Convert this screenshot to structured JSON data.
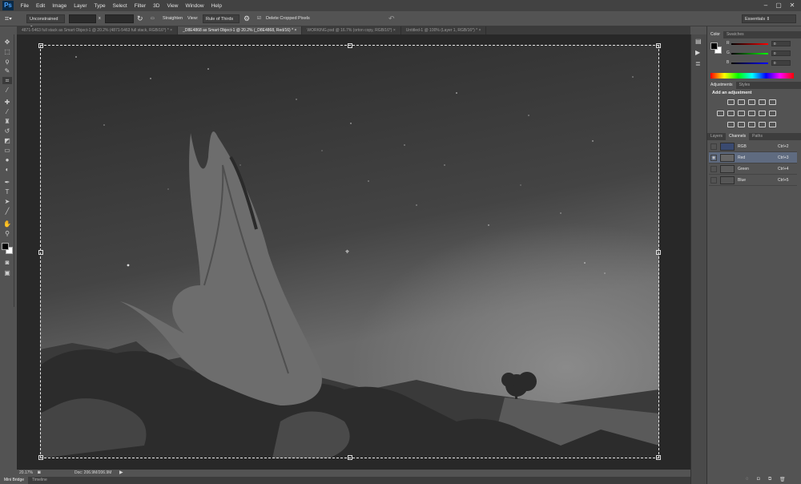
{
  "app": {
    "logo": "Ps"
  },
  "menu": [
    "File",
    "Edit",
    "Image",
    "Layer",
    "Type",
    "Select",
    "Filter",
    "3D",
    "View",
    "Window",
    "Help"
  ],
  "window_controls": {
    "minimize": "–",
    "maximize": "▢",
    "close": "✕"
  },
  "options_bar": {
    "ratio_preset": "Unconstrained",
    "ratio_separator": "x",
    "straighten_label": "Straighten",
    "view_label": "View:",
    "view_value": "Rule of Thirds",
    "delete_cropped_label": "Delete Cropped Pixels",
    "delete_cropped_checked": true,
    "workspace": "Essentials"
  },
  "doc_tabs": [
    {
      "title": "4871-5463 full stack as Smart Object-1 @ 20.2% (4871-5463 full stack, RGB/16*) *",
      "active": false
    },
    {
      "title": "_D8E4868 as Smart Object-1 @ 20.2% (_D8E4868, Red/16) *",
      "active": true
    },
    {
      "title": "WORKING.psd @ 16.7% (orton copy, RGB/16*)",
      "active": false
    },
    {
      "title": "Untitled-1 @ 100% (Layer 1, RGB/16*) *",
      "active": false
    }
  ],
  "tab_close": "×",
  "status": {
    "zoom": "20.17%",
    "doc": "Doc: 206.9M/206.9M"
  },
  "bottom_tabs": [
    "Mini Bridge",
    "Timeline"
  ],
  "color_panel": {
    "tabs": [
      "Color",
      "Swatches"
    ],
    "sliders": [
      {
        "label": "R",
        "value": "0"
      },
      {
        "label": "G",
        "value": "0"
      },
      {
        "label": "B",
        "value": "0"
      }
    ]
  },
  "adjustments_panel": {
    "tabs": [
      "Adjustments",
      "Styles"
    ],
    "heading": "Add an adjustment"
  },
  "layers_panel": {
    "tabs": [
      "Layers",
      "Channels",
      "Paths"
    ],
    "channels": [
      {
        "name": "RGB",
        "shortcut": "Ctrl+2",
        "selected": false,
        "visible": false
      },
      {
        "name": "Red",
        "shortcut": "Ctrl+3",
        "selected": true,
        "visible": true
      },
      {
        "name": "Green",
        "shortcut": "Ctrl+4",
        "selected": false,
        "visible": false
      },
      {
        "name": "Blue",
        "shortcut": "Ctrl+5",
        "selected": false,
        "visible": false
      }
    ]
  },
  "colors": {
    "accent": "#5f6b80",
    "panel": "#535353",
    "canvas_bg": "#282828"
  }
}
